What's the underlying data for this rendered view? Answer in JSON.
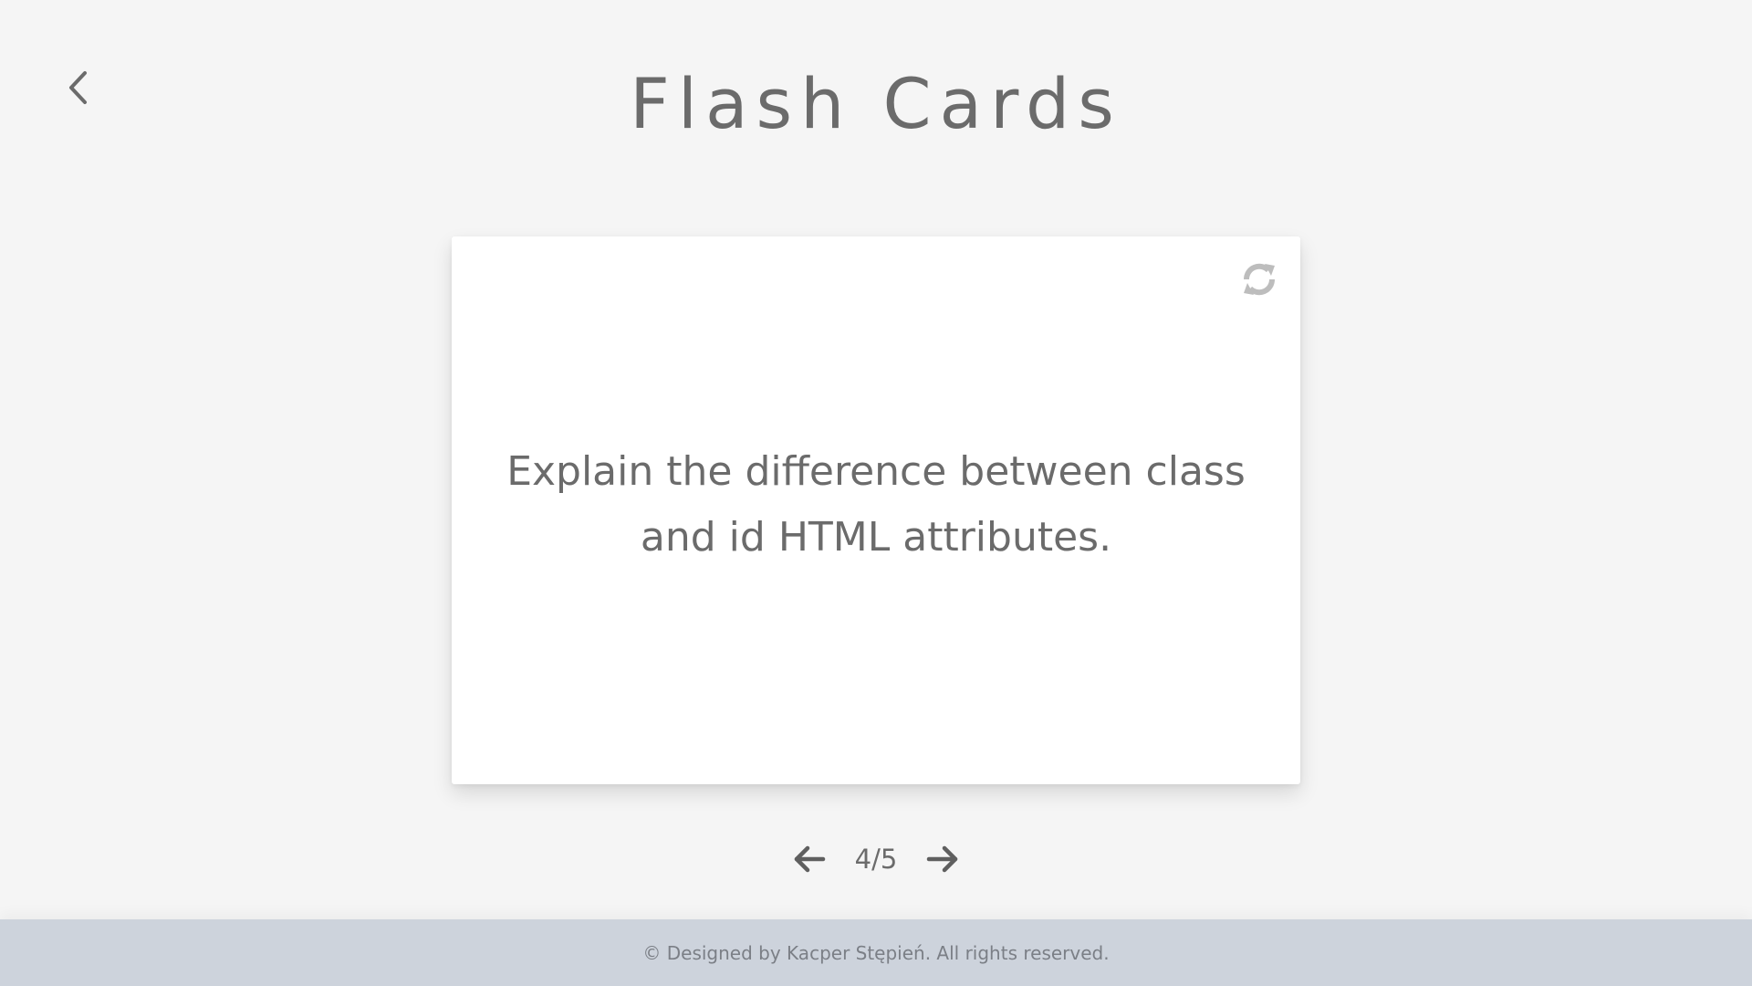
{
  "header": {
    "title": "Flash Cards",
    "back_icon": "chevron-left-icon"
  },
  "card": {
    "question": "Explain the difference between class and id HTML attributes.",
    "flip_icon": "refresh-icon"
  },
  "pager": {
    "position": "4/5",
    "prev_icon": "arrow-left-icon",
    "next_icon": "arrow-right-icon"
  },
  "footer": {
    "text": "© Designed by Kacper Stępień. All rights reserved."
  },
  "colors": {
    "background": "#f5f5f5",
    "card": "#ffffff",
    "text": "#6b6b6b",
    "footer": "#cdd3dc"
  }
}
